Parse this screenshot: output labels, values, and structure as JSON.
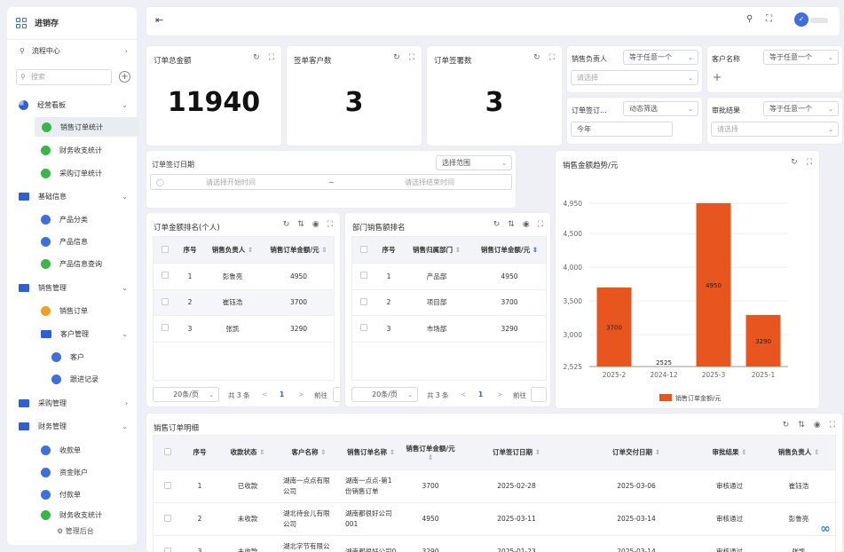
{
  "app": {
    "title": "进销存"
  },
  "sidebar": {
    "process_center": "流程中心",
    "search_placeholder": "搜索",
    "groups": [
      {
        "label": "经营看板"
      },
      {
        "label": "基础信息"
      },
      {
        "label": "销售管理"
      },
      {
        "label": "采购管理"
      },
      {
        "label": "财务管理"
      }
    ],
    "items": {
      "sales_stats": "销售订单统计",
      "finance_stats": "财务收支统计",
      "purchase_stats": "采购订单统计",
      "product_category": "产品分类",
      "product_info": "产品信息",
      "product_query": "产品信息查询",
      "sales_order": "销售订单",
      "customer_mgmt": "客户管理",
      "customer": "客户",
      "follow_up": "跟进记录",
      "receipt": "收款单",
      "fund_account": "资金账户",
      "payment": "付款单",
      "finance_stats2": "财务收支统计"
    },
    "admin": "管理后台"
  },
  "kpis": [
    {
      "label": "订单总金额",
      "value": "11940"
    },
    {
      "label": "签单客户数",
      "value": "3"
    },
    {
      "label": "订单签署数",
      "value": "3"
    }
  ],
  "filters": {
    "sales_owner": {
      "label": "销售负责人",
      "op": "等于任意一个",
      "placeholder": "请选择"
    },
    "customer_name": {
      "label": "客户名称",
      "op": "等于任意一个",
      "add": "+"
    },
    "order_sign": {
      "label": "订单签订...",
      "op": "动态筛选",
      "value": "今年"
    },
    "approval": {
      "label": "审批结果",
      "op": "等于任意一个",
      "placeholder": "请选择"
    },
    "date_range": {
      "label": "订单签订日期",
      "mode": "选择范围",
      "start_placeholder": "请选择开始时间",
      "sep": "~",
      "end_placeholder": "请选择结束时间"
    }
  },
  "rank_personal": {
    "title": "订单金额排名(个人)",
    "headers": [
      "序号",
      "销售负责人",
      "销售订单金额/元"
    ],
    "rows": [
      [
        "1",
        "彭鲁亮",
        "4950"
      ],
      [
        "2",
        "崔钰浩",
        "3700"
      ],
      [
        "3",
        "张凯",
        "3290"
      ]
    ],
    "page_size": "20条/页",
    "total": "共 3 条",
    "page": "1",
    "goto": "前往"
  },
  "rank_dept": {
    "title": "部门销售额排名",
    "headers": [
      "序号",
      "销售归属部门",
      "销售订单金额/元"
    ],
    "rows": [
      [
        "1",
        "产品部",
        "4950"
      ],
      [
        "2",
        "项目部",
        "3700"
      ],
      [
        "3",
        "市场部",
        "3290"
      ]
    ],
    "page_size": "20条/页",
    "total": "共 3 条",
    "page": "1",
    "goto": "前往"
  },
  "chart_data": {
    "type": "bar",
    "title": "销售金额趋势/元",
    "categories": [
      "2025-2",
      "2024-12",
      "2025-3",
      "2025-1"
    ],
    "series": [
      {
        "name": "销售订单金额/元",
        "values": [
          3700,
          2525,
          4950,
          3290
        ]
      }
    ],
    "ylim": [
      2525,
      4950
    ],
    "yticks": [
      "4,950",
      "4,500",
      "4,000",
      "3,500",
      "3,000",
      "2,525"
    ],
    "data_labels": [
      "3700",
      "2525",
      "4950",
      "3290"
    ],
    "color": "#e8561f",
    "legend": "bottom"
  },
  "detail": {
    "title": "销售订单明细",
    "headers": [
      "序号",
      "收款状态",
      "客户名称",
      "销售订单名称",
      "销售订单金额/元",
      "订单签订日期",
      "订单交付日期",
      "审批结果",
      "销售负责人"
    ],
    "rows": [
      [
        "1",
        "已收款",
        "湖南一点点有限公司",
        "湖南一点点-第1份销售订单",
        "3700",
        "2025-02-28",
        "2025-03-06",
        "审核通过",
        "崔钰浩"
      ],
      [
        "2",
        "未收款",
        "湖北待会儿有限公司",
        "湖南都很好公司001",
        "4950",
        "2025-03-11",
        "2025-03-14",
        "审核通过",
        "彭鲁亮"
      ],
      [
        "3",
        "未收款",
        "湖北字节有限公司",
        "湖南都很好公司0",
        "3290",
        "2025-01-23",
        "2025-03-14",
        "审核通过",
        "张凯"
      ]
    ]
  }
}
